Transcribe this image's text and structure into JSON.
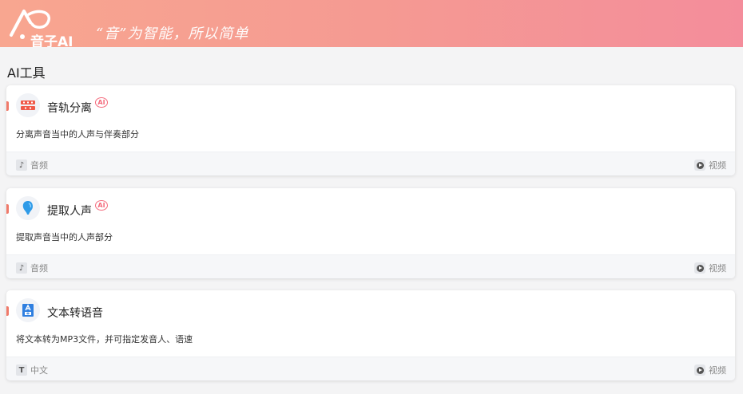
{
  "header": {
    "logo_text": "音子AI",
    "slogan": "“音”为智能，所以简单"
  },
  "section_title": "AI工具",
  "tools": [
    {
      "name": "音轨分离",
      "ai": "AI",
      "description": "分离声音当中的人声与伴奏部分",
      "tag_icon": "music-note-icon",
      "tag": "音频",
      "video": "视频"
    },
    {
      "name": "提取人声",
      "ai": "AI",
      "description": "提取声音当中的人声部分",
      "tag_icon": "music-note-icon",
      "tag": "音频",
      "video": "视频"
    },
    {
      "name": "文本转语音",
      "description": "将文本转为MP3文件，并可指定发音人、语速",
      "tag_icon": "text-t-icon",
      "tag": "中文",
      "video": "视频"
    }
  ],
  "colors": {
    "banner_start": "#f8a690",
    "banner_end": "#f48d9b",
    "accent": "#f07a6a",
    "ai_badge": "#f46b7d"
  }
}
